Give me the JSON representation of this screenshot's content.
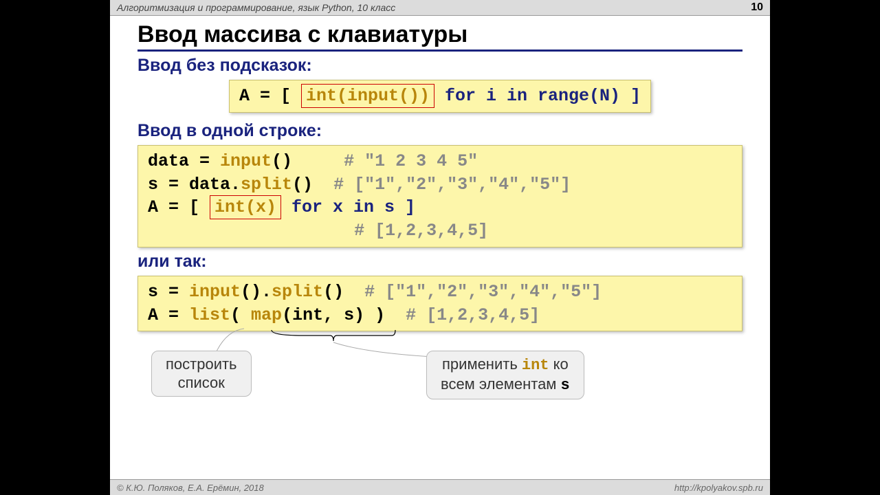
{
  "header": {
    "course": "Алгоритмизация и программирование, язык Python, 10 класс",
    "page": "10"
  },
  "title": "Ввод массива с клавиатуры",
  "sec1": {
    "heading": "Ввод без подсказок:",
    "c": {
      "a": "A = [ ",
      "box": "int(input())",
      "rest": " for i in range(N) ]"
    }
  },
  "sec2": {
    "heading": "Ввод в одной строке:",
    "c": {
      "l1a": "data = ",
      "l1b": "input",
      "l1c": "()     ",
      "l1d": "# \"1 2 3 4 5\"",
      "l2a": "s = data.",
      "l2b": "split",
      "l2c": "()  ",
      "l2d": "# [\"1\",\"2\",\"3\",\"4\",\"5\"]",
      "l3a": "A = [ ",
      "l3box": "int(x)",
      "l3b": " for x in s ]",
      "l4pad": "                    ",
      "l4": "# [1,2,3,4,5]"
    }
  },
  "sec3": {
    "heading": "или так:",
    "c": {
      "l1a": "s = ",
      "l1b": "input",
      "l1c": "().",
      "l1d": "split",
      "l1e": "()  ",
      "l1f": "# [\"1\",\"2\",\"3\",\"4\",\"5\"]",
      "l2a": "A = ",
      "l2b": "list",
      "l2c": "( ",
      "l2d": "map",
      "l2e": "(int, s) )  ",
      "l2f": "# [1,2,3,4,5]"
    }
  },
  "callout1": {
    "l1": "построить",
    "l2": "список"
  },
  "callout2": {
    "pre": "применить ",
    "fn": "int",
    "post": " ко",
    "l2a": "всем элементам ",
    "l2b": "s"
  },
  "footer": {
    "copyright": "© К.Ю. Поляков, Е.А. Ерёмин, 2018",
    "url": "http://kpolyakov.spb.ru"
  }
}
